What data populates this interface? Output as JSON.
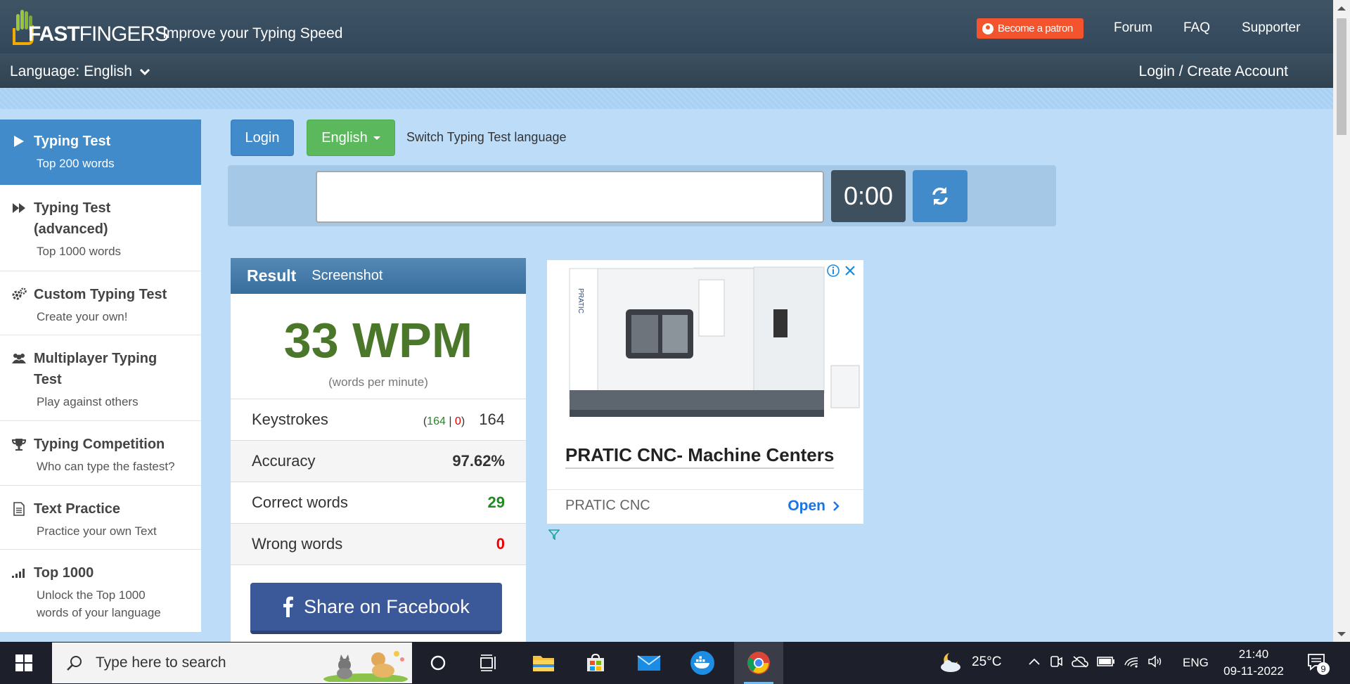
{
  "header": {
    "logo_bold": "FAST",
    "logo_light": "FINGERS",
    "tagline": "Improve your Typing Speed",
    "patron_label": "Become a patron",
    "nav": [
      "Forum",
      "FAQ",
      "Supporter"
    ],
    "language_label": "Language: English",
    "login_label": "Login / Create Account"
  },
  "sidebar": {
    "items": [
      {
        "title": "Typing Test",
        "sub": "Top 200 words",
        "icon": "play-icon",
        "active": true
      },
      {
        "title": "Typing Test (advanced)",
        "sub": "Top 1000 words",
        "icon": "fast-forward-icon"
      },
      {
        "title": "Custom Typing Test",
        "sub": "Create your own!",
        "icon": "gears-icon"
      },
      {
        "title": "Multiplayer Typing Test",
        "sub": "Play against others",
        "icon": "users-icon"
      },
      {
        "title": "Typing Competition",
        "sub": "Who can type the fastest?",
        "icon": "trophy-icon"
      },
      {
        "title": "Text Practice",
        "sub": "Practice your own Text",
        "icon": "document-icon"
      },
      {
        "title": "Top 1000",
        "sub": "Unlock the Top 1000 words of your language",
        "icon": "signal-bars-icon"
      }
    ]
  },
  "controls": {
    "login_button": "Login",
    "language_button": "English",
    "switch_text": "Switch Typing Test language",
    "input_value": "",
    "timer": "0:00"
  },
  "result": {
    "title": "Result",
    "screenshot_label": "Screenshot",
    "wpm": "33 WPM",
    "wpm_sub": "(words per minute)",
    "keystrokes_label": "Keystrokes",
    "keystrokes_correct": "164",
    "keystrokes_wrong": "0",
    "keystrokes_total": "164",
    "accuracy_label": "Accuracy",
    "accuracy": "97.62%",
    "correct_label": "Correct words",
    "correct": "29",
    "wrong_label": "Wrong words",
    "wrong": "0",
    "facebook_label": "Share on Facebook"
  },
  "ad": {
    "title": "PRATIC CNC- Machine Centers",
    "brand": "PRATIC CNC",
    "open_label": "Open",
    "machine_label": "PRATIC"
  },
  "taskbar": {
    "search_placeholder": "Type here to search",
    "temperature": "25°C",
    "language": "ENG",
    "time": "21:40",
    "date": "09-11-2022",
    "notification_count": "9",
    "pinned_icons": [
      "cortana-icon",
      "task-view-icon",
      "file-explorer-icon",
      "microsoft-store-icon",
      "mail-icon",
      "docker-icon",
      "chrome-icon"
    ]
  },
  "colors": {
    "header": "#3a4e5f",
    "page_bg": "#bcdcf8",
    "primary": "#428bca",
    "success": "#5cb85c",
    "wpm_green": "#4a7729",
    "facebook": "#3b5998",
    "patron": "#f4542d"
  }
}
